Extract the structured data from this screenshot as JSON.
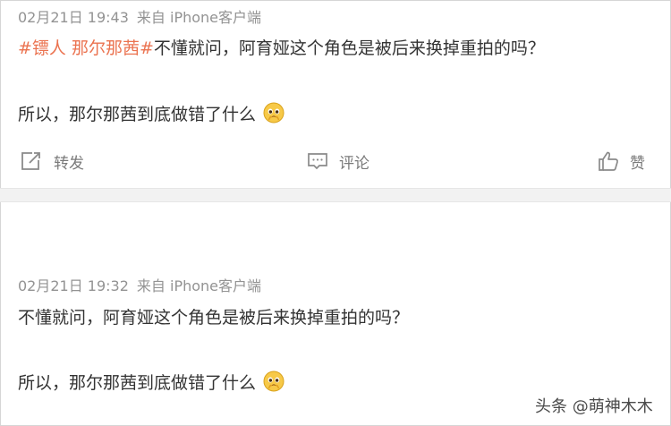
{
  "post1": {
    "date": "02月21日 19:43",
    "source": "来自 iPhone客户端",
    "hashtag": "#镖人 那尔那茜#",
    "line1_text": "不懂就问，阿育娅这个角色是被后来换掉重拍的吗？",
    "line2_text": "所以，那尔那茜到底做错了什么",
    "emoji_icon": "pleading-face-icon",
    "actions": {
      "repost_label": "转发",
      "comment_label": "评论",
      "like_label": "赞"
    }
  },
  "post2": {
    "date": "02月21日 19:32",
    "source": "来自 iPhone客户端",
    "line1_text": "不懂就问，阿育娅这个角色是被后来换掉重拍的吗？",
    "line2_text": "所以，那尔那茜到底做错了什么",
    "emoji_icon": "pleading-face-icon"
  },
  "watermark": "头条 @萌神木木",
  "colors": {
    "hashtag": "#eb7350",
    "meta": "#939393",
    "body_text": "#333333",
    "action_text": "#7a7a7a"
  }
}
